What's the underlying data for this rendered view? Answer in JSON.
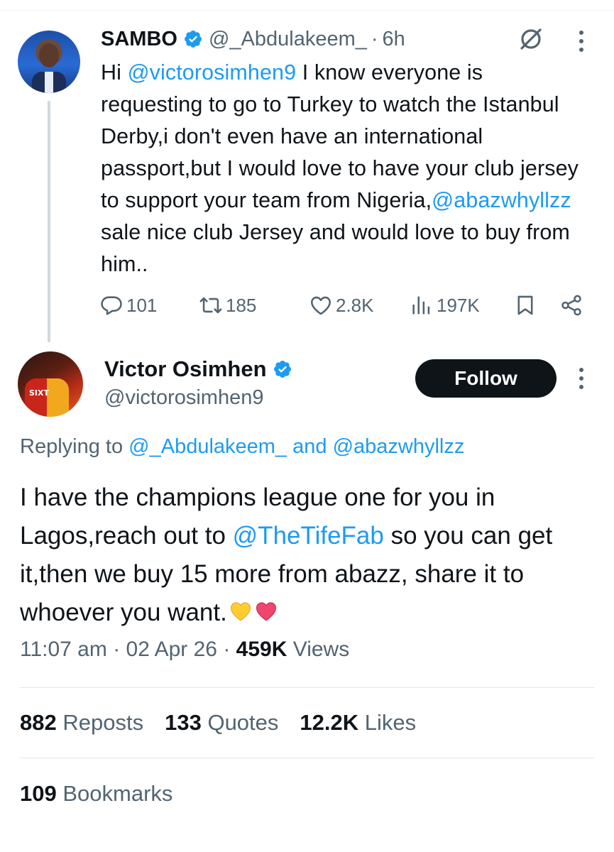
{
  "parent_tweet": {
    "author_name": "SAMBO",
    "handle": "@_Abdulakeem_",
    "separator": "·",
    "time": "6h",
    "body": {
      "part1": "Hi ",
      "mention1": "@victorosimhen9",
      "part2": " I know everyone is requesting to go to Turkey to watch the Istanbul Derby,i don't even have an international passport,but I would love to have your club jersey to support your team from Nigeria,",
      "mention2": "@abazwhyllzz",
      "part3": " sale nice club Jersey and would love to buy from him.."
    },
    "actions": {
      "replies": "101",
      "reposts": "185",
      "likes": "2.8K",
      "views": "197K"
    }
  },
  "main_tweet": {
    "author_name": "Victor Osimhen",
    "handle": "@victorosimhen9",
    "follow_label": "Follow",
    "replying_prefix": "Replying to ",
    "replying_to_1": "@_Abdulakeem_",
    "replying_and": " and ",
    "replying_to_2": "@abazwhyllzz",
    "body": {
      "part1": "I have the champions league one for you in Lagos,reach out to ",
      "mention": "@TheTifeFab",
      "part2": " so you can get it,then we buy 15 more from abazz, share it to whoever you want."
    },
    "emojis": [
      "yellow-heart",
      "pink-heart"
    ],
    "time": "11:07 am",
    "date": "02 Apr 26",
    "separator": "·",
    "views_count": "459K",
    "views_label": "Views",
    "stats": {
      "reposts_count": "882",
      "reposts_label": "Reposts",
      "quotes_count": "133",
      "quotes_label": "Quotes",
      "likes_count": "12.2K",
      "likes_label": "Likes",
      "bookmarks_count": "109",
      "bookmarks_label": "Bookmarks"
    }
  },
  "colors": {
    "text_primary": "#0f1419",
    "text_secondary": "#536471",
    "link": "#1d9bf0",
    "verified": "#1d9bf0",
    "follow_bg": "#0f1419"
  },
  "icons": [
    "verified-badge-icon",
    "grok-icon",
    "more-icon",
    "reply-icon",
    "repost-icon",
    "like-icon",
    "views-icon",
    "bookmark-icon",
    "share-icon"
  ]
}
